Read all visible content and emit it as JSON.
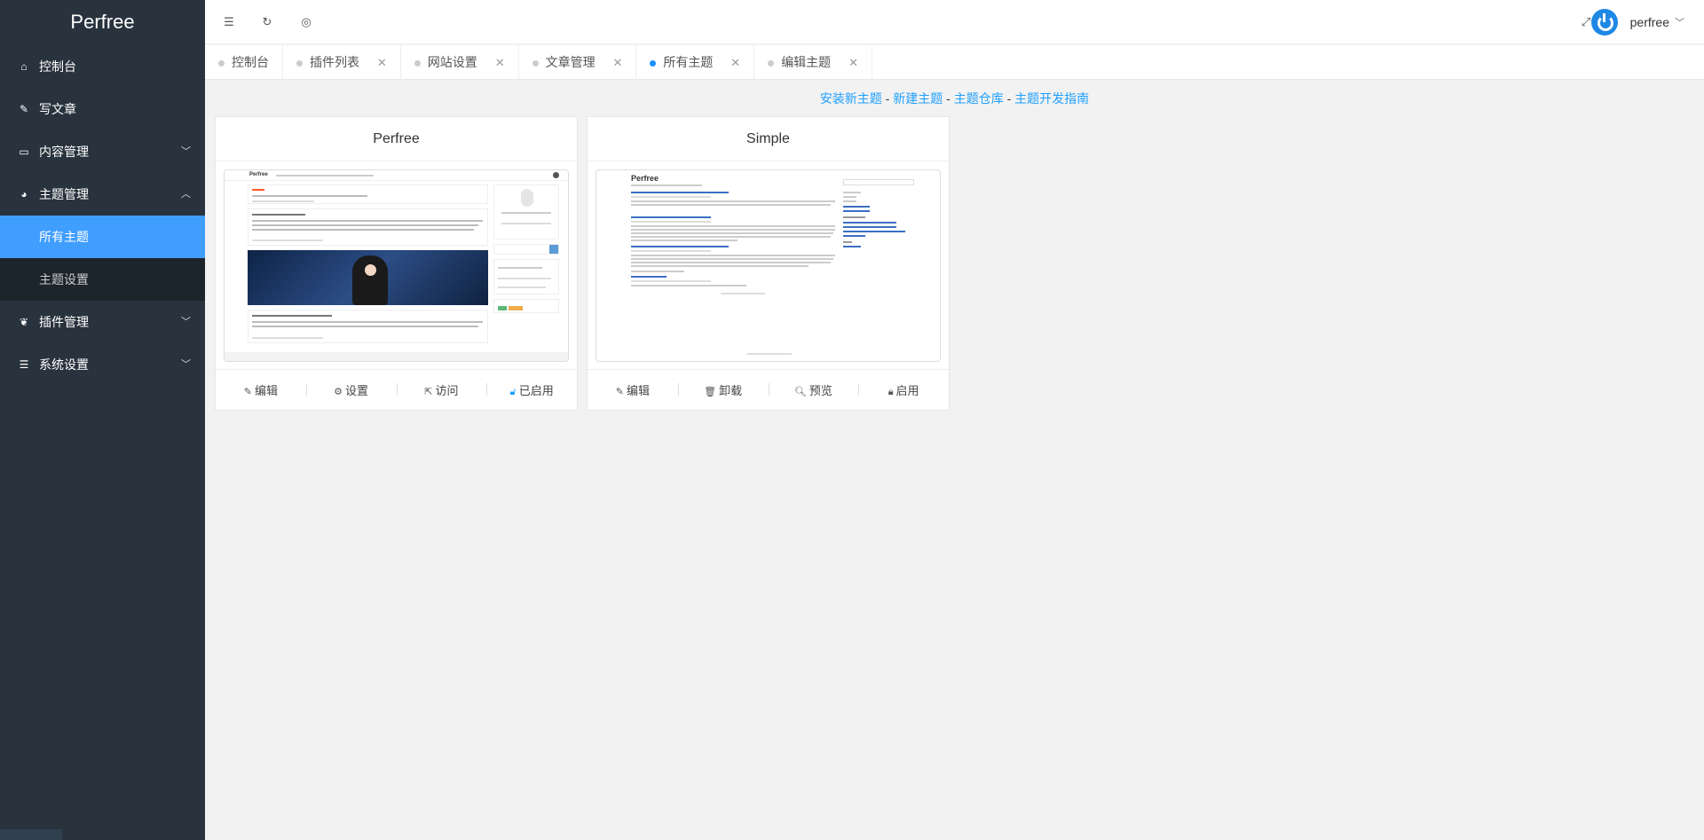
{
  "sidebar": {
    "logo": "Perfree",
    "menu": [
      {
        "label": "控制台",
        "icon": "home-icon"
      },
      {
        "label": "写文章",
        "icon": "edit-icon"
      },
      {
        "label": "内容管理",
        "icon": "inbox-icon"
      },
      {
        "label": "主题管理",
        "icon": "dashboard-icon"
      },
      {
        "label": "插件管理",
        "icon": "leaf-icon"
      },
      {
        "label": "系统设置",
        "icon": "sliders-icon"
      }
    ],
    "theme_submenu": [
      "所有主题",
      "主题设置"
    ]
  },
  "header": {
    "icons": [
      "menu-fold-icon",
      "refresh-icon",
      "globe-icon",
      "fullscreen-icon"
    ],
    "user_name": "perfree"
  },
  "tabs": [
    {
      "label": "控制台",
      "closable": false
    },
    {
      "label": "插件列表",
      "closable": true
    },
    {
      "label": "网站设置",
      "closable": true
    },
    {
      "label": "文章管理",
      "closable": true
    },
    {
      "label": "所有主题",
      "closable": true,
      "active": true
    },
    {
      "label": "编辑主题",
      "closable": true
    }
  ],
  "top_links": {
    "install": "安装新主题",
    "create": "新建主题",
    "repo": "主题仓库",
    "guide": "主题开发指南",
    "separator": "-"
  },
  "themes": [
    {
      "name": "Perfree",
      "actions": [
        "编辑",
        "设置",
        "访问",
        "已启用"
      ],
      "preview": {
        "brand": "Perfree"
      }
    },
    {
      "name": "Simple",
      "actions": [
        "编辑",
        "卸载",
        "预览",
        "启用"
      ],
      "preview": {
        "brand": "Perfree"
      }
    }
  ],
  "colors": {
    "sidebar_bg": "#28333e",
    "active_blue": "#409eff",
    "link_blue": "#1e9fff"
  }
}
